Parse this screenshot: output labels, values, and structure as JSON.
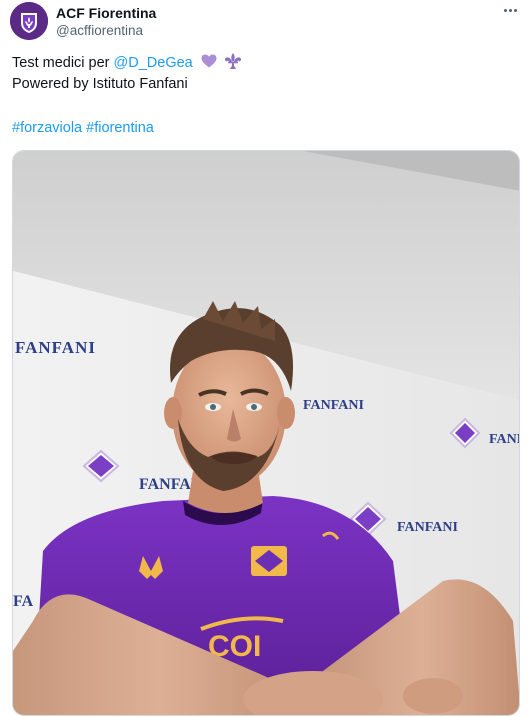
{
  "account": {
    "display_name": "ACF Fiorentina",
    "handle": "@acffiorentina",
    "avatar_icon": "fiorentina-crest-icon",
    "menu_icon": "more-options-icon"
  },
  "tweet": {
    "text_prefix": "Test medici per ",
    "mention": "@D_DeGea",
    "heart_emoji": "purple-heart-icon",
    "fleur_emoji": "fleur-de-lis-icon",
    "line2": "Powered by Istituto Fanfani",
    "hashtag1": "#forzaviola",
    "hashtag2": "#fiorentina"
  },
  "media": {
    "description_icon": "photo-goalkeeper",
    "backdrop_text": "FANFANI",
    "shirt_text": "COI"
  },
  "colors": {
    "accent": "#1d9bf0",
    "club_purple": "#6b2fb3",
    "text": "#0f1419",
    "secondary": "#536471"
  }
}
